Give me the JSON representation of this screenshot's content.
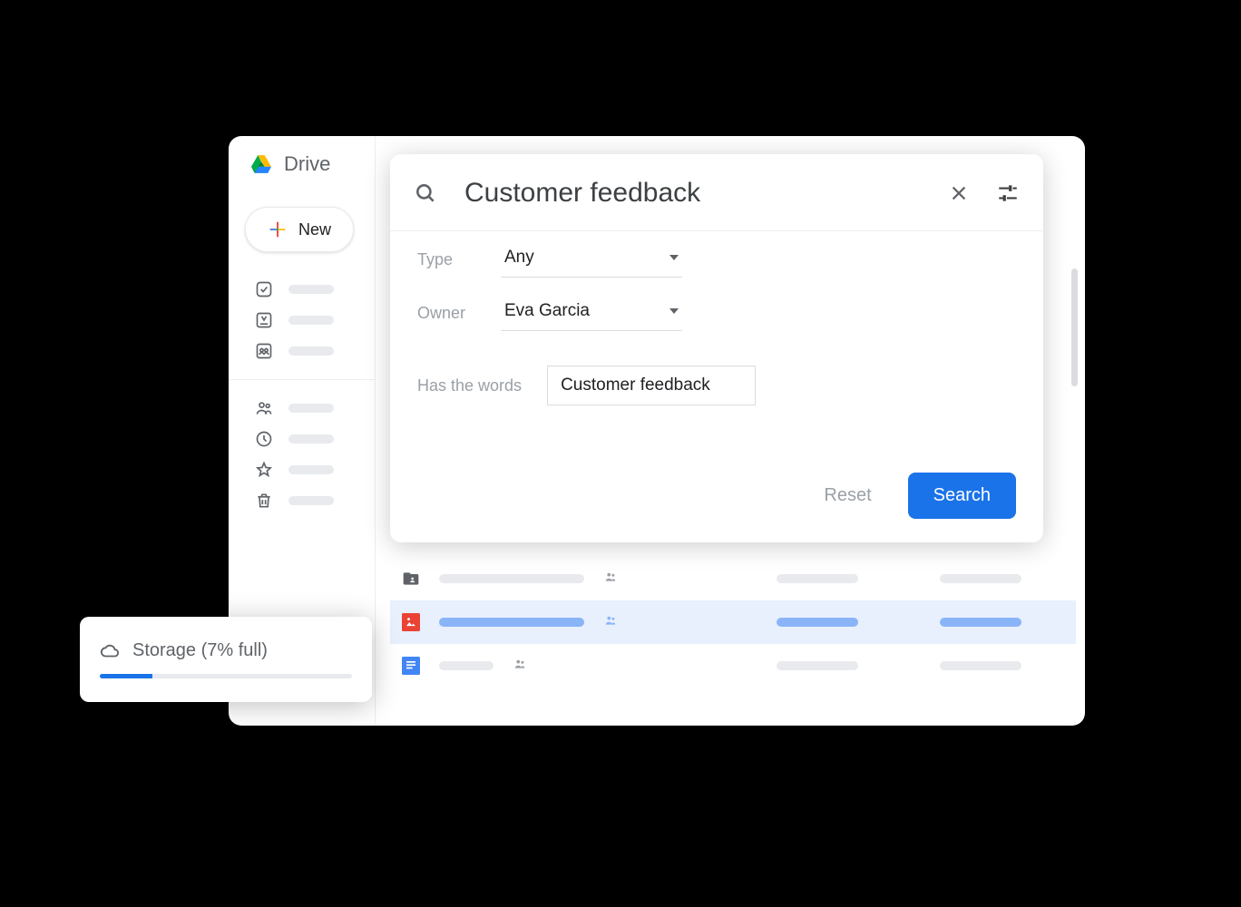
{
  "app": {
    "name": "Drive"
  },
  "new_button": {
    "label": "New"
  },
  "search": {
    "query": "Customer feedback",
    "filters": {
      "type_label": "Type",
      "type_value": "Any",
      "owner_label": "Owner",
      "owner_value": "Eva Garcia",
      "words_label": "Has the words",
      "words_value": "Customer feedback"
    },
    "reset": "Reset",
    "search": "Search"
  },
  "storage": {
    "label": "Storage (7% full)",
    "percent": 7
  }
}
